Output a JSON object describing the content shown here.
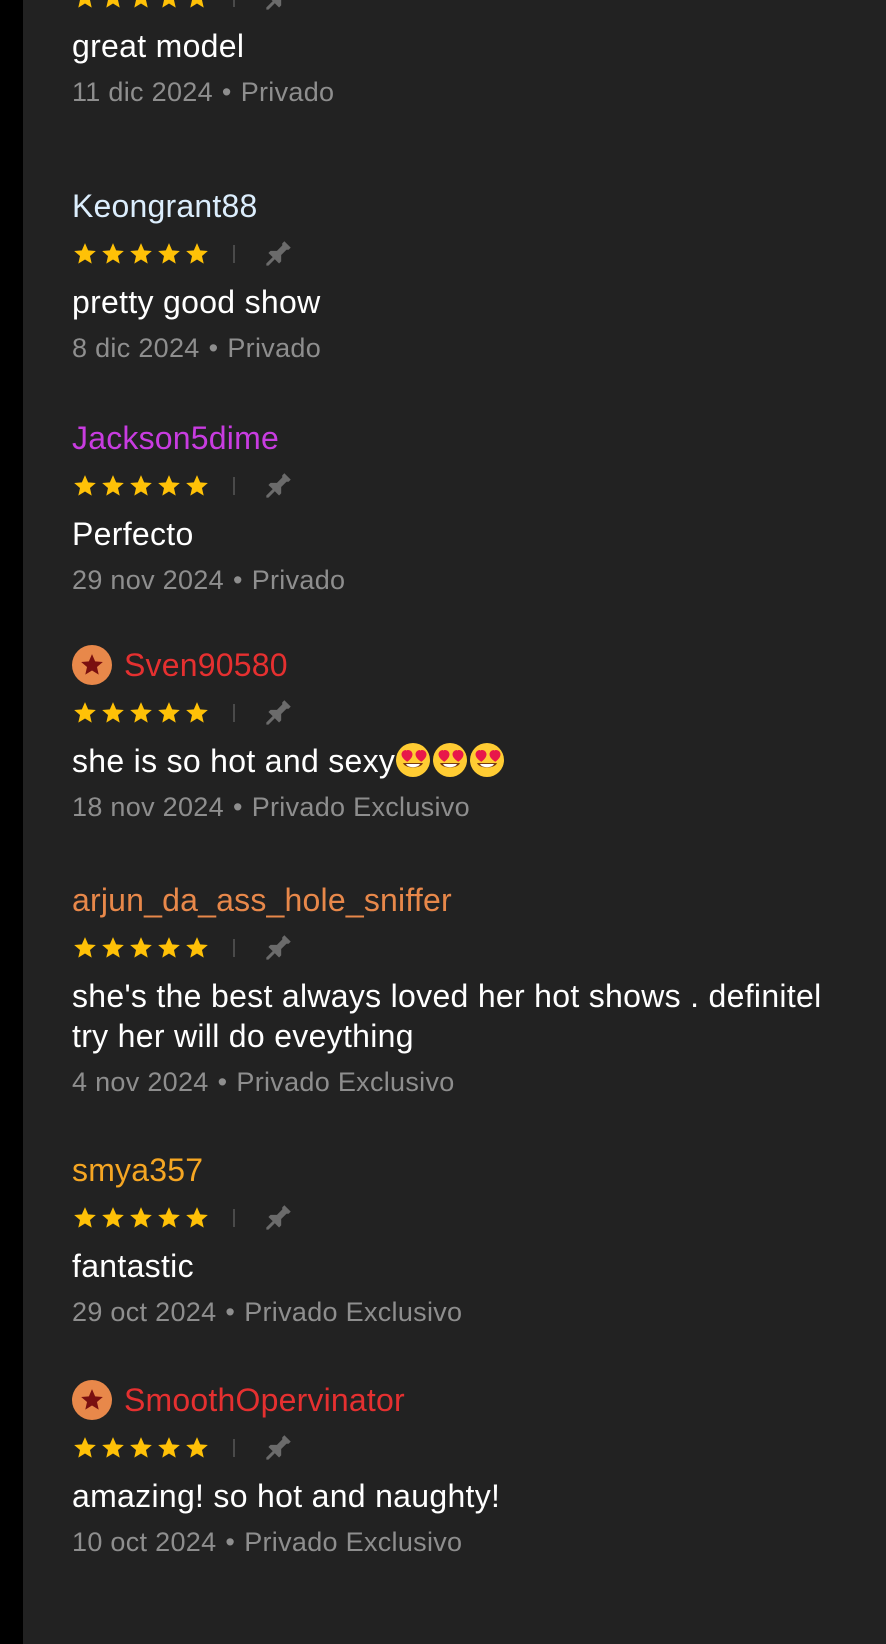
{
  "colors": {
    "background": "#222222",
    "star": "#ffc107",
    "pin": "#6b6b6b",
    "text": "#ffffff",
    "meta": "#8e8e8e",
    "badge": "#e8884a"
  },
  "reviews": [
    {
      "username": "",
      "username_color": "",
      "badge": false,
      "stars": 5,
      "comment": "great model",
      "date": "11 dic 2024",
      "type": "Privado",
      "separator": "•"
    },
    {
      "username": "Keongrant88",
      "username_color": "#dceefd",
      "badge": false,
      "stars": 5,
      "comment": "pretty good show",
      "date": "8 dic 2024",
      "type": "Privado",
      "separator": "•"
    },
    {
      "username": "Jackson5dime",
      "username_color": "#c83ce0",
      "badge": false,
      "stars": 5,
      "comment": "Perfecto",
      "date": "29 nov 2024",
      "type": "Privado",
      "separator": "•"
    },
    {
      "username": "Sven90580",
      "username_color": "#e53030",
      "badge": true,
      "stars": 5,
      "comment": "she is so hot and sexy",
      "comment_emoji": "heart-eyes-emoji",
      "comment_emoji_count": 3,
      "date": "18 nov 2024",
      "type": "Privado Exclusivo",
      "separator": "•"
    },
    {
      "username": "arjun_da_ass_hole_sniffer",
      "username_color": "#e8884a",
      "badge": false,
      "stars": 5,
      "comment": "she's the best always loved her hot shows . definitel\ntry her will do eveything",
      "date": "4 nov 2024",
      "type": "Privado Exclusivo",
      "separator": "•"
    },
    {
      "username": "smya357",
      "username_color": "#f5a623",
      "badge": false,
      "stars": 5,
      "comment": "fantastic",
      "date": "29 oct 2024",
      "type": "Privado Exclusivo",
      "separator": "•"
    },
    {
      "username": "SmoothOpervinator",
      "username_color": "#e53030",
      "badge": true,
      "stars": 5,
      "comment": "amazing! so hot and naughty!",
      "date": "10 oct 2024",
      "type": "Privado Exclusivo",
      "separator": "•"
    }
  ],
  "icons": {
    "star": "star-icon",
    "pin": "pin-icon",
    "badge": "star-badge-icon",
    "emoji": "heart-eyes-emoji"
  }
}
